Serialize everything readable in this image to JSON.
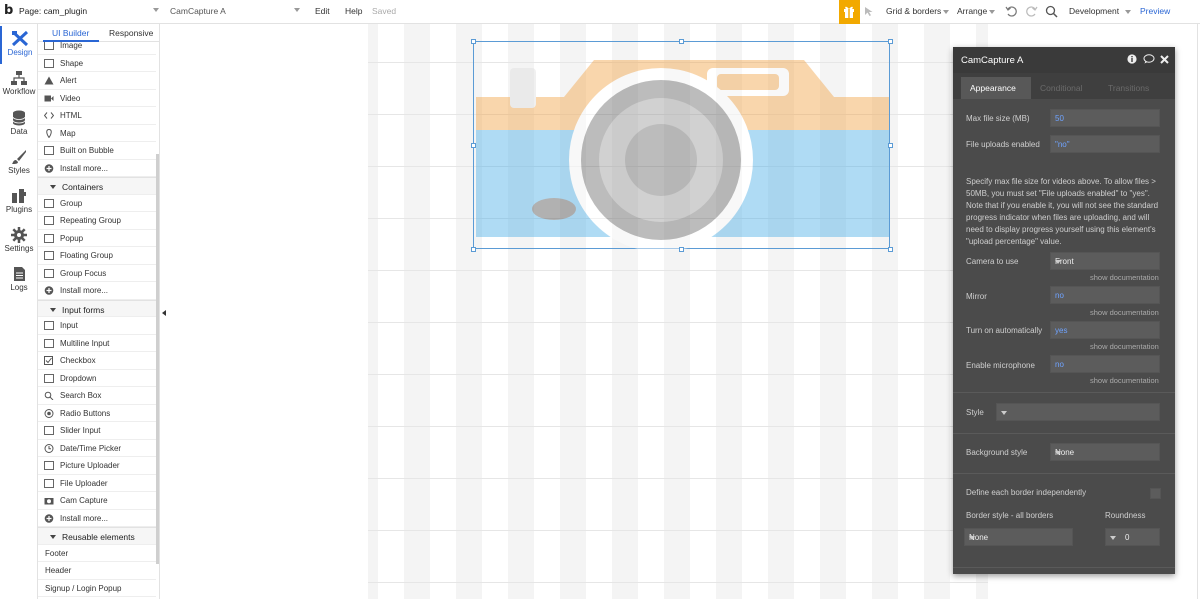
{
  "topbar": {
    "logo": "b",
    "page_select": "Page: cam_plugin",
    "element_select": "CamCapture A",
    "edit": "Edit",
    "help": "Help",
    "saved": "Saved",
    "grid": "Grid & borders",
    "arrange": "Arrange",
    "env": "Development",
    "preview": "Preview",
    "accent": "#2a66d4",
    "gift_color": "#f2a900"
  },
  "rail": {
    "items": [
      {
        "label": "Design",
        "icon": "design-icon"
      },
      {
        "label": "Workflow",
        "icon": "workflow-icon"
      },
      {
        "label": "Data",
        "icon": "data-icon"
      },
      {
        "label": "Styles",
        "icon": "styles-icon"
      },
      {
        "label": "Plugins",
        "icon": "plugins-icon"
      },
      {
        "label": "Settings",
        "icon": "settings-icon"
      },
      {
        "label": "Logs",
        "icon": "logs-icon"
      }
    ]
  },
  "palette": {
    "tabs": [
      "UI Builder",
      "Responsive"
    ],
    "rows": [
      {
        "label": "Image",
        "type": "item",
        "icon": "image-icon"
      },
      {
        "label": "Shape",
        "type": "item",
        "icon": "shape-icon"
      },
      {
        "label": "Alert",
        "type": "item",
        "icon": "alert-icon"
      },
      {
        "label": "Video",
        "type": "item",
        "icon": "video-icon"
      },
      {
        "label": "HTML",
        "type": "item",
        "icon": "html-icon"
      },
      {
        "label": "Map",
        "type": "item",
        "icon": "map-icon"
      },
      {
        "label": "Built on Bubble",
        "type": "item",
        "icon": "bubble-icon"
      },
      {
        "label": "Install more...",
        "type": "item",
        "icon": "plus-icon"
      },
      {
        "label": "Containers",
        "type": "section"
      },
      {
        "label": "Group",
        "type": "item",
        "icon": "group-icon"
      },
      {
        "label": "Repeating Group",
        "type": "item",
        "icon": "repeating-group-icon"
      },
      {
        "label": "Popup",
        "type": "item",
        "icon": "popup-icon"
      },
      {
        "label": "Floating Group",
        "type": "item",
        "icon": "floating-group-icon"
      },
      {
        "label": "Group Focus",
        "type": "item",
        "icon": "group-focus-icon"
      },
      {
        "label": "Install more...",
        "type": "item",
        "icon": "plus-icon"
      },
      {
        "label": "Input forms",
        "type": "section"
      },
      {
        "label": "Input",
        "type": "item",
        "icon": "input-icon"
      },
      {
        "label": "Multiline Input",
        "type": "item",
        "icon": "multiline-icon"
      },
      {
        "label": "Checkbox",
        "type": "item",
        "icon": "checkbox-icon"
      },
      {
        "label": "Dropdown",
        "type": "item",
        "icon": "dropdown-icon"
      },
      {
        "label": "Search Box",
        "type": "item",
        "icon": "search-box-icon"
      },
      {
        "label": "Radio Buttons",
        "type": "item",
        "icon": "radio-icon"
      },
      {
        "label": "Slider Input",
        "type": "item",
        "icon": "slider-icon"
      },
      {
        "label": "Date/Time Picker",
        "type": "item",
        "icon": "clock-icon"
      },
      {
        "label": "Picture Uploader",
        "type": "item",
        "icon": "picture-uploader-icon"
      },
      {
        "label": "File Uploader",
        "type": "item",
        "icon": "file-uploader-icon"
      },
      {
        "label": "Cam Capture",
        "type": "item",
        "icon": "camera-icon"
      },
      {
        "label": "Install more...",
        "type": "item",
        "icon": "plus-icon"
      },
      {
        "label": "Reusable elements",
        "type": "section"
      },
      {
        "label": "Footer",
        "type": "plain"
      },
      {
        "label": "Header",
        "type": "plain"
      },
      {
        "label": "Signup / Login Popup",
        "type": "plain"
      }
    ]
  },
  "props": {
    "title": "CamCapture A",
    "tabs": [
      "Appearance",
      "Conditional",
      "Transitions"
    ],
    "max_file_label": "Max file size (MB)",
    "max_file_value": "50",
    "uploads_label": "File uploads enabled",
    "uploads_value": "\"no\"",
    "help_text": "Specify max file size for videos above. To allow files > 50MB, you must set \"File uploads enabled\" to \"yes\". Note that if you enable it, you will not see the standard progress indicator when files are uploading, and will need to display progress yourself using this element's \"upload percentage\" value.",
    "camera_label": "Camera to use",
    "camera_value": "Front",
    "mirror_label": "Mirror",
    "mirror_value": "no",
    "turn_on_label": "Turn on automatically",
    "turn_on_value": "yes",
    "mic_label": "Enable microphone",
    "mic_value": "no",
    "show_doc": "show documentation",
    "style_label": "Style",
    "style_value": "",
    "bg_label": "Background style",
    "bg_value": "None",
    "border_each_label": "Define each border independently",
    "border_style_label": "Border style - all borders",
    "border_style_value": "None",
    "roundness_label": "Roundness",
    "roundness_value": "0"
  }
}
